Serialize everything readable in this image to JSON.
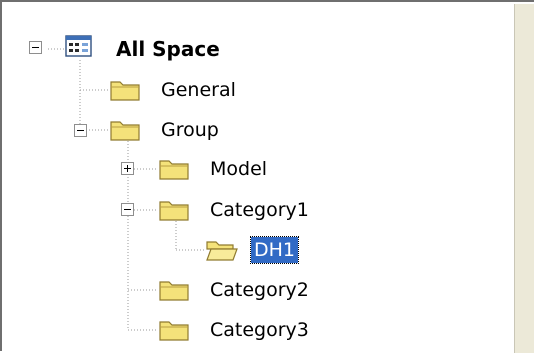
{
  "tree": {
    "root": {
      "label": "All Space",
      "icon": "space-grid-icon",
      "expanded": true
    },
    "items": [
      {
        "label": "General",
        "icon": "folder-icon",
        "level": 1,
        "expandable": false
      },
      {
        "label": "Group",
        "icon": "folder-icon",
        "level": 1,
        "expandable": true,
        "expanded": true
      },
      {
        "label": "Model",
        "icon": "folder-icon",
        "level": 2,
        "expandable": true,
        "expanded": false
      },
      {
        "label": "Category1",
        "icon": "folder-icon",
        "level": 2,
        "expandable": true,
        "expanded": true
      },
      {
        "label": "DH1",
        "icon": "folder-open-icon",
        "level": 3,
        "expandable": false,
        "selected": true
      },
      {
        "label": "Category2",
        "icon": "folder-icon",
        "level": 2,
        "expandable": false
      },
      {
        "label": "Category3",
        "icon": "folder-icon",
        "level": 2,
        "expandable": false
      }
    ]
  },
  "colors": {
    "selection": "#316ac5",
    "folder": "#f4e27a"
  }
}
